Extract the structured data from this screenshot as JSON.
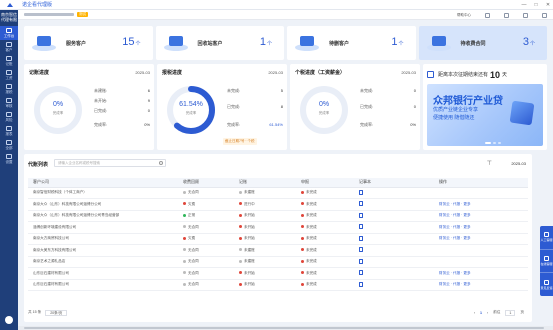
{
  "app": {
    "title": "诺企看代理版"
  },
  "sidebar": {
    "org": "南京智信代理有限",
    "items": [
      {
        "label": "工作台",
        "active": true
      },
      {
        "label": "客户"
      },
      {
        "label": "记账"
      },
      {
        "label": "工资"
      },
      {
        "label": "报税"
      },
      {
        "label": "审核"
      },
      {
        "label": "风险"
      },
      {
        "label": "报表"
      },
      {
        "label": "全部"
      },
      {
        "label": "设置"
      }
    ]
  },
  "header": {
    "tag": "测试",
    "help": "帮助中心"
  },
  "stats": [
    {
      "label": "服务客户",
      "value": "15",
      "unit": "个"
    },
    {
      "label": "回收站客户",
      "value": "1",
      "unit": "个"
    },
    {
      "label": "待删客户",
      "value": "1",
      "unit": "个"
    },
    {
      "label": "待收费合同",
      "value": "3",
      "unit": "个"
    }
  ],
  "panels": [
    {
      "title": "记账进度",
      "date": "2025-03",
      "percent": "0%",
      "sub": "完成率",
      "rows": [
        {
          "k": "未建账:",
          "v": "6"
        },
        {
          "k": "未开始:",
          "v": "9"
        },
        {
          "k": "已完成:",
          "v": "0"
        },
        {
          "k": "完成率:",
          "v": "0%"
        }
      ]
    },
    {
      "title": "报税进度",
      "date": "2025-03",
      "percent": "61.54%",
      "sub": "完成率",
      "progress": 0.6154,
      "rows": [
        {
          "k": "未完成:",
          "v": "5"
        },
        {
          "k": "已完成:",
          "v": "8"
        },
        {
          "k": "完成率:",
          "v": "61.54%"
        }
      ],
      "note": "截止日期7号 · 个税"
    },
    {
      "title": "个税进度（工资薪金）",
      "date": "2025-03",
      "percent": "0%",
      "sub": "完成率",
      "rows": [
        {
          "k": "未完成:",
          "v": "0"
        },
        {
          "k": "已完成:",
          "v": "0"
        },
        {
          "k": "完成率:",
          "v": "0%"
        }
      ]
    }
  ],
  "deadline": {
    "prefix": "距离本次征期结束还有",
    "days": "10",
    "unit": "天"
  },
  "ad": {
    "title": "众邦银行产业贷",
    "line1": "优质产业链企业专享",
    "line2": "便捷使用 随借随还"
  },
  "list": {
    "title": "代账列表",
    "search_placeholder": "请输入企业名称或税号搜索",
    "date": "2025-03",
    "columns": [
      "客户公司",
      "收费回顾",
      "记账",
      "申报",
      "记事本",
      "操作"
    ],
    "rows": [
      {
        "company": "南京智信财税科技（个体工商户）",
        "fee": "无合同",
        "fee_color": "#bbbbbb",
        "book": "未建账",
        "book_color": "#bbbbbb",
        "tax": "未完成",
        "tax_color": "#e0463a",
        "note": true,
        "ops": ""
      },
      {
        "company": "南京大众（山东）科技有限公司淄博分公司",
        "fee": "欠费",
        "fee_color": "#e0463a",
        "book": "进行中",
        "book_color": "#e0463a",
        "tax": "未完成",
        "tax_color": "#e0463a",
        "note": true,
        "ops": "财务云 · 代报 · 更多"
      },
      {
        "company": "南京大众（山东）科技有限公司淄博分公司青岛经营部",
        "fee": "正常",
        "fee_color": "#2fb65a",
        "book": "未开始",
        "book_color": "#e0463a",
        "tax": "未完成",
        "tax_color": "#e0463a",
        "note": true,
        "ops": "财务云 · 代报 · 更多"
      },
      {
        "company": "淄博创新环境建设有限公司",
        "fee": "无合同",
        "fee_color": "#bbbbbb",
        "book": "未开始",
        "book_color": "#e0463a",
        "tax": "未完成",
        "tax_color": "#e0463a",
        "note": true,
        "ops": "财务云 · 代报 · 更多"
      },
      {
        "company": "南京大方商贸科技公司",
        "fee": "欠费",
        "fee_color": "#e0463a",
        "book": "未开始",
        "book_color": "#e0463a",
        "tax": "未完成",
        "tax_color": "#e0463a",
        "note": true,
        "ops": "财务云 · 代报 · 更多"
      },
      {
        "company": "南京大美东方科技有限公司",
        "fee": "无合同",
        "fee_color": "#bbbbbb",
        "book": "未建账",
        "book_color": "#bbbbbb",
        "tax": "未完成",
        "tax_color": "#e0463a",
        "note": true,
        "ops": ""
      },
      {
        "company": "南京艺术之源礼品店",
        "fee": "无合同",
        "fee_color": "#bbbbbb",
        "book": "未建账",
        "book_color": "#bbbbbb",
        "tax": "未完成",
        "tax_color": "#e0463a",
        "note": true,
        "ops": ""
      },
      {
        "company": "山东巨石建材有限公司",
        "fee": "无合同",
        "fee_color": "#bbbbbb",
        "book": "未开始",
        "book_color": "#e0463a",
        "tax": "未完成",
        "tax_color": "#e0463a",
        "note": true,
        "ops": "财务云 · 代报 · 更多"
      },
      {
        "company": "山东巨石建材有限公司",
        "fee": "无合同",
        "fee_color": "#bbbbbb",
        "book": "未开始",
        "book_color": "#e0463a",
        "tax": "未完成",
        "tax_color": "#e0463a",
        "note": true,
        "ops": "财务云 · 代报 · 更多"
      }
    ],
    "pager": {
      "total": "共 15 条",
      "size": "20条/页",
      "page": "1",
      "goto_label": "前往",
      "goto_value": "1",
      "page_unit": "页"
    }
  },
  "float_tools": [
    "人工客服",
    "在线客服",
    "意见反馈"
  ],
  "colors": {
    "primary": "#2d5bd2",
    "sidebar": "#1f3f7a",
    "danger": "#e0463a",
    "success": "#2fb65a"
  }
}
